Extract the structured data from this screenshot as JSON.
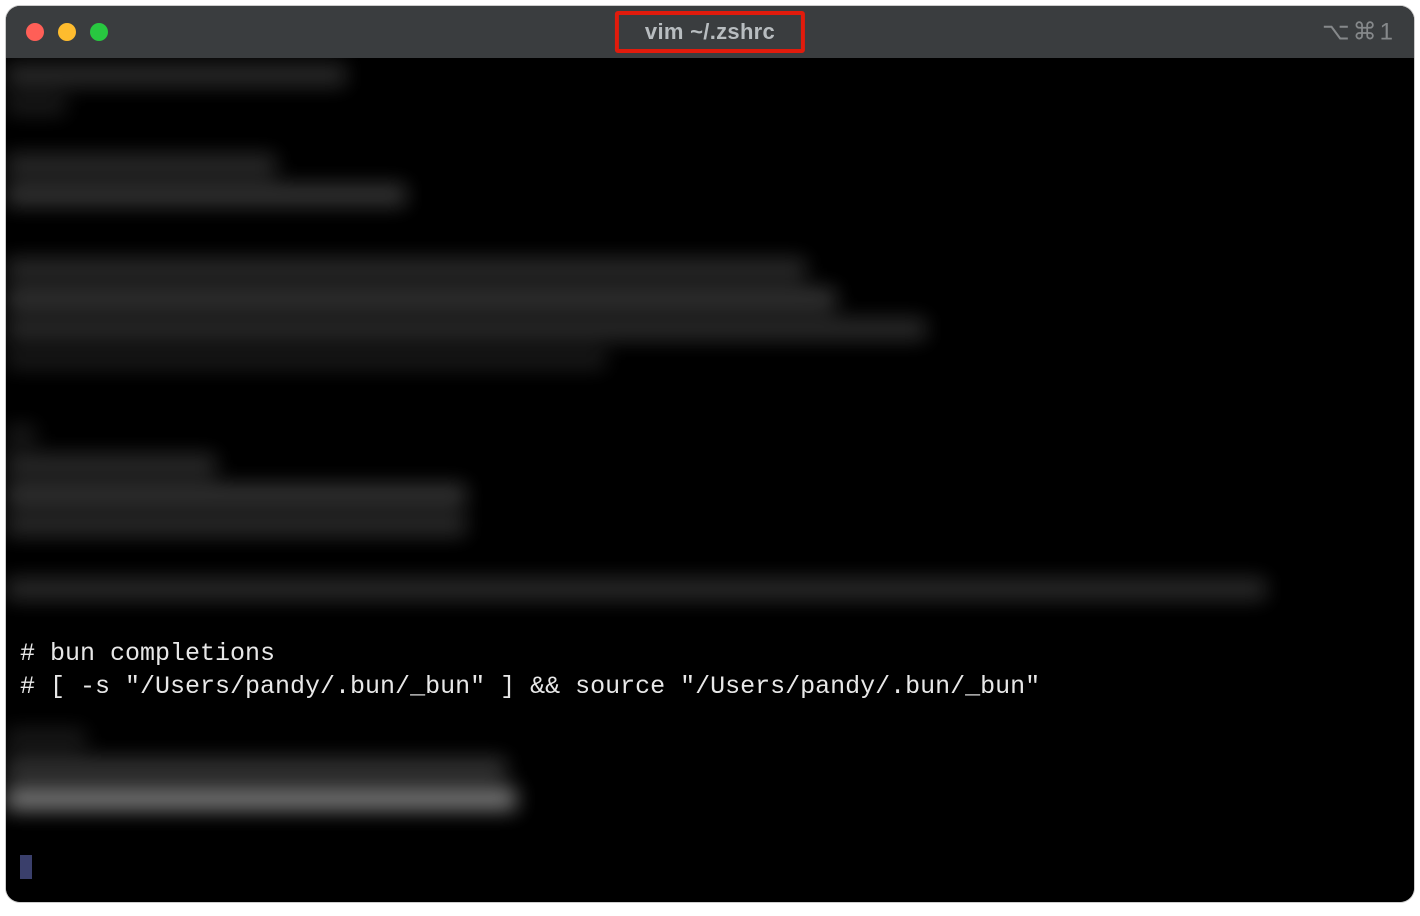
{
  "window": {
    "title": "vim ~/.zshrc",
    "shortcut_indicator": "⌥⌘1"
  },
  "terminal": {
    "visible_lines": [
      "# bun completions",
      "# [ -s \"/Users/pandy/.bun/_bun\" ] && source \"/Users/pandy/.bun/_bun\""
    ],
    "redacted_region_note": "surrounding lines are pixelated/obscured in the screenshot"
  },
  "colors": {
    "titlebar_bg": "#3a3d3f",
    "highlight_border": "#e11b0c",
    "terminal_bg": "#000000",
    "terminal_fg": "#e6e6e6"
  }
}
